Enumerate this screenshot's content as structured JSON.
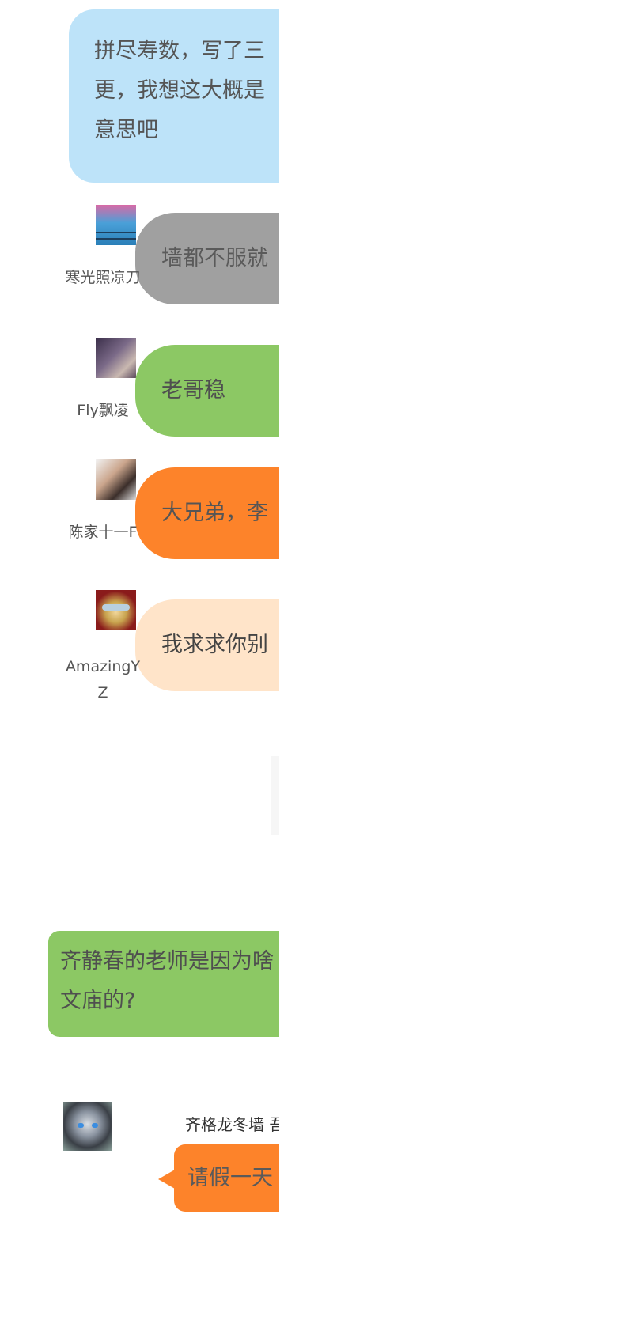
{
  "messages": {
    "top_bubble": {
      "lines": [
        "拼尽寿数，写了三",
        "更，我想这大概是",
        "意思吧"
      ],
      "color": "#bde3f9"
    },
    "comments": [
      {
        "user": "寒光照凉刀",
        "text": "墙都不服就",
        "color": "#a0a0a0",
        "avatar": "sunset-avatar"
      },
      {
        "user": "Fly飘凌",
        "text": "老哥稳",
        "color": "#8cc864",
        "avatar": "dark-photo-avatar"
      },
      {
        "user": "陈家十一F",
        "text": "大兄弟，李",
        "color": "#fd832a",
        "avatar": "woman-avatar"
      },
      {
        "user": "AmazingYZ",
        "text": "我求求你别",
        "color": "#ffe4c9",
        "avatar": "mask-avatar"
      }
    ],
    "question_bubble": {
      "lines": [
        "齐静春的老师是因为啥",
        "文庙的?"
      ],
      "color": "#8cc864"
    },
    "reply": {
      "author": "齐格龙冬墙 吾",
      "text": "请假一天",
      "color": "#fd832a",
      "avatar": "cat-avatar"
    }
  }
}
